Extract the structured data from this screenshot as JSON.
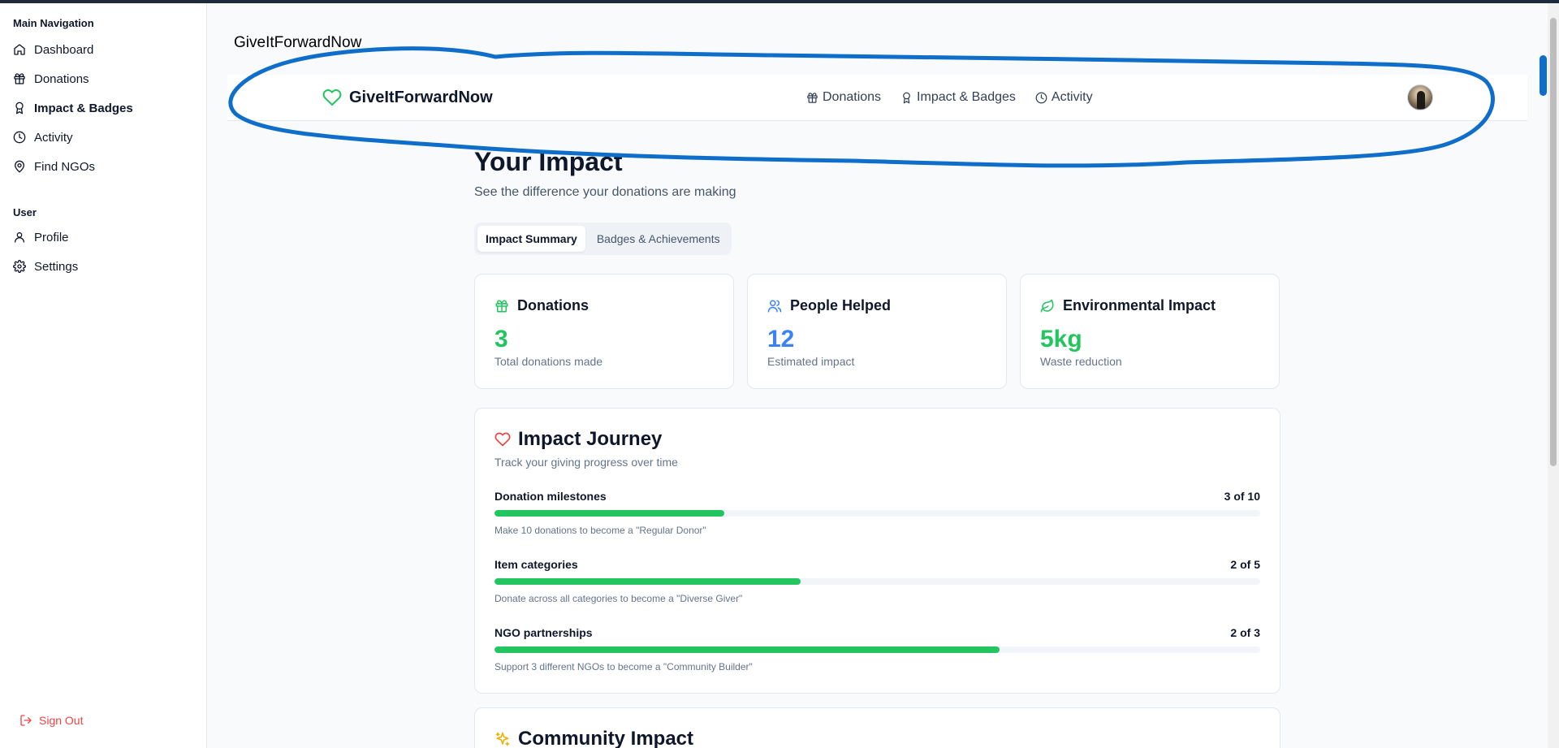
{
  "window": {
    "title": "GiveItForwardNow"
  },
  "sidebar": {
    "main_label": "Main Navigation",
    "main_items": [
      {
        "label": "Dashboard",
        "icon": "home-icon"
      },
      {
        "label": "Donations",
        "icon": "gift-icon"
      },
      {
        "label": "Impact & Badges",
        "icon": "award-icon",
        "active": true
      },
      {
        "label": "Activity",
        "icon": "clock-icon"
      },
      {
        "label": "Find NGOs",
        "icon": "map-pin-icon"
      }
    ],
    "user_label": "User",
    "user_items": [
      {
        "label": "Profile",
        "icon": "user-icon"
      },
      {
        "label": "Settings",
        "icon": "gear-icon"
      }
    ],
    "signout_label": "Sign Out"
  },
  "header": {
    "brand": "GiveItForwardNow",
    "nav": [
      {
        "label": "Donations",
        "icon": "gift-icon"
      },
      {
        "label": "Impact & Badges",
        "icon": "award-icon"
      },
      {
        "label": "Activity",
        "icon": "clock-icon"
      }
    ]
  },
  "main": {
    "title": "Your Impact",
    "subtitle": "See the difference your donations are making",
    "tabs": [
      {
        "label": "Impact Summary",
        "active": true
      },
      {
        "label": "Badges & Achievements",
        "active": false
      }
    ],
    "stats": [
      {
        "title": "Donations",
        "value": "3",
        "caption": "Total donations made",
        "color": "#22c55e",
        "icon": "gift-icon"
      },
      {
        "title": "People Helped",
        "value": "12",
        "caption": "Estimated impact",
        "color": "#3b82f6",
        "icon": "users-icon"
      },
      {
        "title": "Environmental Impact",
        "value": "5kg",
        "caption": "Waste reduction",
        "color": "#22c55e",
        "icon": "leaf-icon"
      }
    ],
    "journey": {
      "title": "Impact Journey",
      "subtitle": "Track your giving progress over time",
      "milestones": [
        {
          "label": "Donation milestones",
          "count": "3 of 10",
          "progress": 0.3,
          "hint": "Make 10 donations to become a \"Regular Donor\""
        },
        {
          "label": "Item categories",
          "count": "2 of 5",
          "progress": 0.4,
          "hint": "Donate across all categories to become a \"Diverse Giver\""
        },
        {
          "label": "NGO partnerships",
          "count": "2 of 3",
          "progress": 0.66,
          "hint": "Support 3 different NGOs to become a \"Community Builder\""
        }
      ]
    },
    "community": {
      "title": "Community Impact"
    }
  },
  "colors": {
    "accent_green": "#22c55e",
    "accent_blue": "#3b82f6",
    "danger": "#ef4444",
    "annotation": "#0f6ec9"
  }
}
